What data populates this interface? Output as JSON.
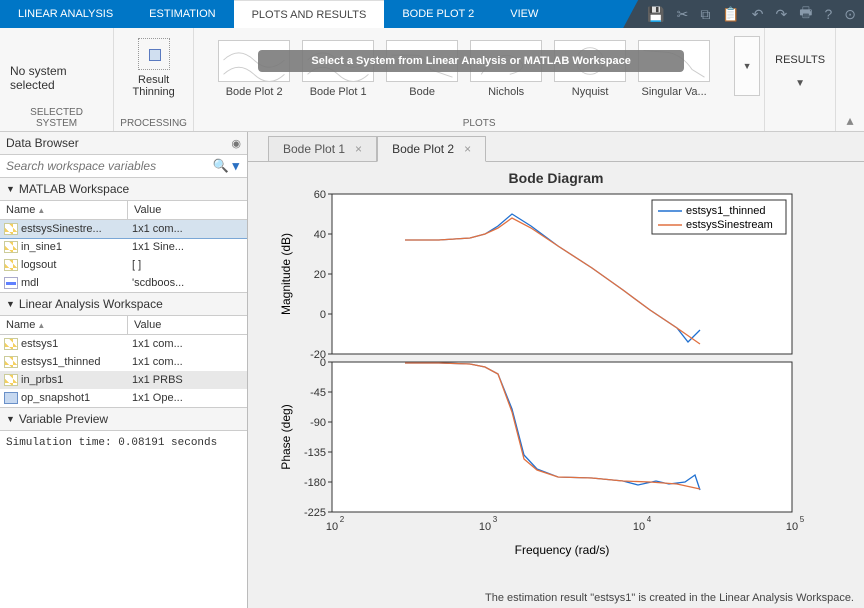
{
  "topTabs": {
    "items": [
      {
        "label": "LINEAR ANALYSIS",
        "active": false
      },
      {
        "label": "ESTIMATION",
        "active": false
      },
      {
        "label": "PLOTS AND RESULTS",
        "active": true
      },
      {
        "label": "BODE PLOT 2",
        "active": false
      },
      {
        "label": "VIEW",
        "active": false
      }
    ]
  },
  "ribbon": {
    "selected": {
      "text": "No system selected",
      "group": "SELECTED SYSTEM"
    },
    "processing": {
      "btn": "Result\nThinning",
      "group": "PROCESSING"
    },
    "plots": {
      "group": "PLOTS",
      "overlay": "Select a System from Linear Analysis or MATLAB Workspace",
      "items": [
        "Bode Plot 2",
        "Bode Plot 1",
        "Bode",
        "Nichols",
        "Nyquist",
        "Singular Va..."
      ]
    },
    "results": {
      "btn": "RESULTS"
    }
  },
  "sidebar": {
    "dataBrowser": "Data Browser",
    "searchPlaceholder": "Search workspace variables",
    "matlabWs": {
      "title": "MATLAB Workspace",
      "cols": [
        "Name",
        "Value"
      ],
      "rows": [
        {
          "name": "estsysSinestre...",
          "value": "1x1 com...",
          "ico": "struct",
          "sel": true
        },
        {
          "name": "in_sine1",
          "value": "1x1 Sine...",
          "ico": "struct"
        },
        {
          "name": "logsout",
          "value": "[ ]",
          "ico": "struct"
        },
        {
          "name": "mdl",
          "value": "'scdboos...",
          "ico": "sig"
        }
      ]
    },
    "linWs": {
      "title": "Linear Analysis Workspace",
      "cols": [
        "Name",
        "Value"
      ],
      "rows": [
        {
          "name": "estsys1",
          "value": "1x1 com...",
          "ico": "struct"
        },
        {
          "name": "estsys1_thinned",
          "value": "1x1 com...",
          "ico": "struct"
        },
        {
          "name": "in_prbs1",
          "value": "1x1 PRBS",
          "ico": "struct",
          "sel2": true
        },
        {
          "name": "op_snapshot1",
          "value": "1x1 Ope...",
          "ico": "blue"
        }
      ]
    },
    "preview": {
      "title": "Variable Preview",
      "text": "Simulation time: 0.08191 seconds"
    }
  },
  "docTabs": [
    {
      "label": "Bode Plot 1",
      "active": false
    },
    {
      "label": "Bode Plot 2",
      "active": true
    }
  ],
  "plot": {
    "title": "Bode Diagram",
    "xlabel": "Frequency  (rad/s)",
    "mag": {
      "ylabel": "Magnitude (dB)"
    },
    "phase": {
      "ylabel": "Phase (deg)"
    },
    "legend": [
      "estsys1_thinned",
      "estsysSinestream"
    ]
  },
  "statusbar": "The estimation result \"estsys1\" is created in the Linear Analysis Workspace.",
  "chart_data": [
    {
      "type": "line",
      "title": "Magnitude (dB)",
      "xlabel": "Frequency (rad/s)",
      "ylabel": "Magnitude (dB)",
      "xscale": "log",
      "xlim": [
        100,
        100000
      ],
      "ylim": [
        -20,
        60
      ],
      "yticks": [
        -20,
        0,
        20,
        40,
        60
      ],
      "legend_position": "upper-right",
      "series": [
        {
          "name": "estsys1_thinned",
          "color": "#2070d0",
          "x": [
            300,
            500,
            800,
            1000,
            1200,
            1500,
            2000,
            3000,
            5000,
            8000,
            12000,
            18000,
            21000,
            25000
          ],
          "y": [
            37,
            37,
            38,
            40,
            44,
            50,
            44,
            34,
            23,
            12,
            2,
            -7,
            -14,
            -8
          ]
        },
        {
          "name": "estsysSinestream",
          "color": "#e07040",
          "x": [
            300,
            500,
            800,
            1000,
            1200,
            1500,
            2000,
            3000,
            5000,
            8000,
            12000,
            18000,
            25000
          ],
          "y": [
            37,
            37,
            38,
            40,
            43,
            48,
            43,
            34,
            23,
            12,
            2,
            -7,
            -15
          ]
        }
      ]
    },
    {
      "type": "line",
      "title": "Phase (deg)",
      "xlabel": "Frequency (rad/s)",
      "ylabel": "Phase (deg)",
      "xscale": "log",
      "xlim": [
        100,
        100000
      ],
      "ylim": [
        -225,
        0
      ],
      "yticks": [
        -225,
        -180,
        -135,
        -90,
        -45,
        0
      ],
      "series": [
        {
          "name": "estsys1_thinned",
          "color": "#2070d0",
          "x": [
            300,
            500,
            800,
            1000,
            1200,
            1500,
            1800,
            2200,
            3000,
            5000,
            8000,
            10000,
            13000,
            16000,
            20000,
            23000,
            25000
          ],
          "y": [
            -2,
            -2,
            -3,
            -7,
            -18,
            -70,
            -140,
            -160,
            -172,
            -174,
            -178,
            -185,
            -178,
            -183,
            -180,
            -170,
            -192
          ]
        },
        {
          "name": "estsysSinestream",
          "color": "#e07040",
          "x": [
            300,
            500,
            800,
            1000,
            1200,
            1500,
            1800,
            2200,
            3000,
            5000,
            8000,
            12000,
            18000,
            25000
          ],
          "y": [
            -2,
            -2,
            -3,
            -7,
            -18,
            -75,
            -145,
            -162,
            -172,
            -174,
            -178,
            -180,
            -183,
            -190
          ]
        }
      ]
    }
  ]
}
